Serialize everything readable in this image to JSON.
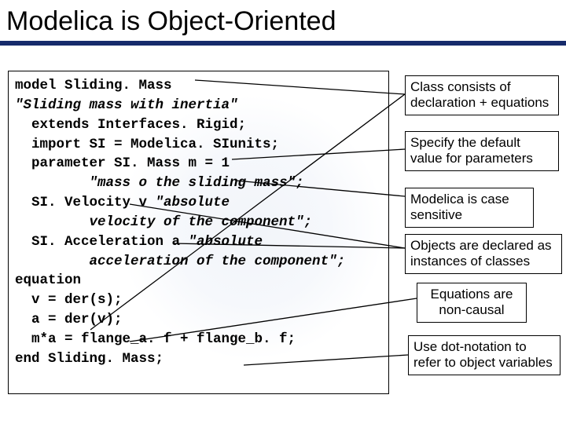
{
  "title": "Modelica is Object-Oriented",
  "code": {
    "l1a": "model",
    "l1b": " Sliding. Mass",
    "l2": "\"Sliding mass with inertia\"",
    "l3": "  extends Interfaces. Rigid;",
    "l4": "  import SI = Modelica. SIunits;",
    "l5": "  parameter SI. Mass m = 1",
    "l5b": "         \"mass o the sliding mass\";",
    "l6a": "  SI. Velocity v ",
    "l6b": "\"absolute",
    "l6c": "         velocity of the component\";",
    "l7a": "  SI. Acceleration a ",
    "l7b": "\"absolute",
    "l7c": "         acceleration of the component\";",
    "l8": "equation",
    "l9": "  v = der(s);",
    "l10": "  a = der(v);",
    "l11": "  m*a = flange_a. f + flange_b. f;",
    "l12": "end Sliding. Mass;"
  },
  "notes": {
    "n1": "Class consists of declaration + equations",
    "n2": "Specify the default value for parameters",
    "n3": "Modelica is case sensitive",
    "n4": "Objects are declared as instances of classes",
    "n5": "Equations are non-causal",
    "n6": "Use dot-notation to refer to object variables"
  }
}
